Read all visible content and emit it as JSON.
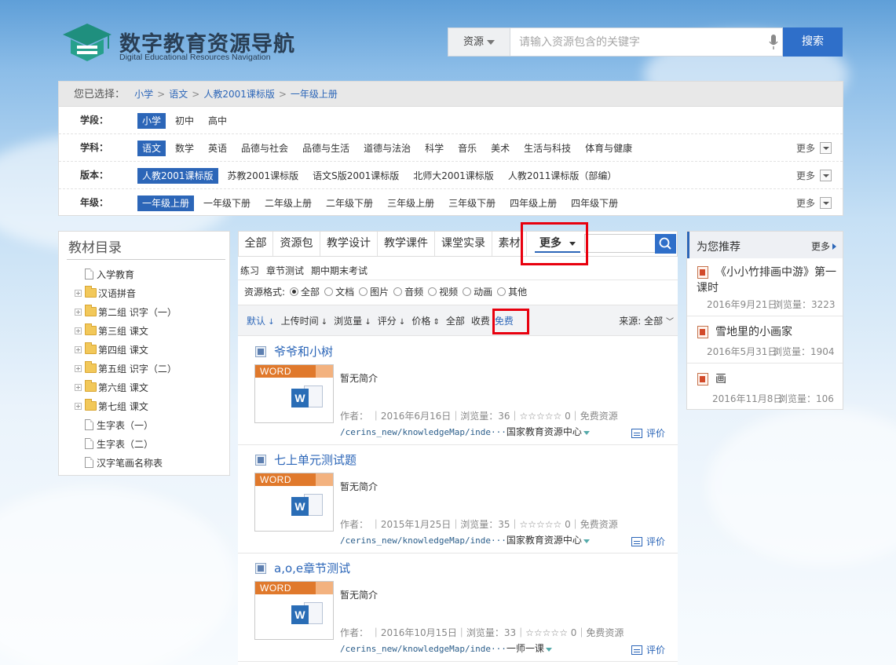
{
  "header": {
    "logo_title": "数字教育资源导航",
    "logo_subtitle": "Digital Educational Resources Navigation",
    "search_type": "资源",
    "search_placeholder": "请输入资源包含的关键字",
    "search_button": "搜索"
  },
  "selection": {
    "label": "您已选择：",
    "crumbs": [
      "小学",
      "语文",
      "人教2001课标版",
      "一年级上册"
    ]
  },
  "filters": [
    {
      "label": "学段：",
      "items": [
        "小学",
        "初中",
        "高中"
      ],
      "active": 0,
      "more": ""
    },
    {
      "label": "学科：",
      "items": [
        "语文",
        "数学",
        "英语",
        "品德与社会",
        "品德与生活",
        "道德与法治",
        "科学",
        "音乐",
        "美术",
        "生活与科技",
        "体育与健康"
      ],
      "active": 0,
      "more": "更多"
    },
    {
      "label": "版本：",
      "items": [
        "人教2001课标版",
        "苏教2001课标版",
        "语文S版2001课标版",
        "北师大2001课标版",
        "人教2011课标版（部编）"
      ],
      "active": 0,
      "more": "更多"
    },
    {
      "label": "年级：",
      "items": [
        "一年级上册",
        "一年级下册",
        "二年级上册",
        "二年级下册",
        "三年级上册",
        "三年级下册",
        "四年级上册",
        "四年级下册"
      ],
      "active": 0,
      "more": "更多"
    }
  ],
  "tree": {
    "title": "教材目录",
    "items": [
      {
        "label": "入学教育",
        "kind": "doc"
      },
      {
        "label": "汉语拼音",
        "kind": "folder"
      },
      {
        "label": "第二组 识字（一）",
        "kind": "folder"
      },
      {
        "label": "第三组 课文",
        "kind": "folder"
      },
      {
        "label": "第四组 课文",
        "kind": "folder"
      },
      {
        "label": "第五组 识字（二）",
        "kind": "folder"
      },
      {
        "label": "第六组 课文",
        "kind": "folder"
      },
      {
        "label": "第七组 课文",
        "kind": "folder"
      },
      {
        "label": "生字表（一）",
        "kind": "doc"
      },
      {
        "label": "生字表（二）",
        "kind": "doc"
      },
      {
        "label": "汉字笔画名称表",
        "kind": "doc"
      }
    ]
  },
  "tabs": [
    "全部",
    "资源包",
    "教学设计",
    "教学课件",
    "课堂实录",
    "素材",
    "更多"
  ],
  "subtypes": [
    "练习",
    "章节测试",
    "期中期末考试"
  ],
  "format": {
    "label": "资源格式:",
    "options": [
      "全部",
      "文档",
      "图片",
      "音频",
      "视频",
      "动画",
      "其他"
    ],
    "selected": "全部"
  },
  "sortbar": {
    "items": [
      "默认",
      "上传时间",
      "浏览量",
      "评分",
      "价格",
      "全部",
      "收费",
      "免费"
    ],
    "source_label": "来源:",
    "source_value": "全部"
  },
  "results": [
    {
      "title": "爷爷和小树",
      "thumb_label": "WORD",
      "desc": "暂无简介",
      "meta": "作者：  ｜2016年6月16日｜浏览量：36｜☆☆☆☆☆ 0｜免费资源",
      "url": "/cerins_new/knowledgeMap/inde···",
      "org": "国家教育资源中心",
      "rate": "评价"
    },
    {
      "title": "七上单元测试题",
      "thumb_label": "WORD",
      "desc": "暂无简介",
      "meta": "作者：  ｜2015年1月25日｜浏览量：35｜☆☆☆☆☆ 0｜免费资源",
      "url": "/cerins_new/knowledgeMap/inde···",
      "org": "国家教育资源中心",
      "rate": "评价"
    },
    {
      "title": "a,o,e章节测试",
      "thumb_label": "WORD",
      "desc": "暂无简介",
      "meta": "作者：  ｜2016年10月15日｜浏览量：33｜☆☆☆☆☆ 0｜免费资源",
      "url": "/cerins_new/knowledgeMap/inde···",
      "org": "一师一课",
      "rate": "评价"
    }
  ],
  "recommend": {
    "title": "为您推荐",
    "more": "更多",
    "items": [
      {
        "title": "《小小竹排画中游》第一课时",
        "date": "2016年9月21日",
        "views": "浏览量：3223"
      },
      {
        "title": "雪地里的小画家",
        "date": "2016年5月31日",
        "views": "浏览量：1904"
      },
      {
        "title": "画",
        "date": "2016年11月8日",
        "views": "浏览量：106"
      }
    ]
  },
  "colors": {
    "accent": "#2c66b8",
    "highlight_box": "#e8000e",
    "word_orange": "#e0792c"
  }
}
